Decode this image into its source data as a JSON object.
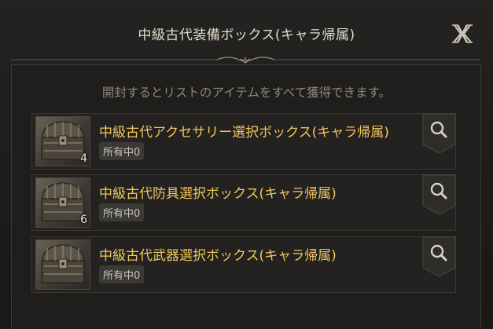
{
  "dialog": {
    "title": "中級古代装備ボックス(キャラ帰属)",
    "subtitle": "開封するとリストのアイテムをすべて獲得できます。"
  },
  "items": [
    {
      "name": "中級古代アクセサリー選択ボックス(キャラ帰属)",
      "count": "4",
      "badge": "所有中0"
    },
    {
      "name": "中級古代防具選択ボックス(キャラ帰属)",
      "count": "6",
      "badge": "所有中0"
    },
    {
      "name": "中級古代武器選択ボックス(キャラ帰属)",
      "count": "",
      "badge": "所有中0"
    }
  ],
  "colors": {
    "title_text": "#e2dccd",
    "item_name": "#f0c65e",
    "subtitle_text": "#8d877b",
    "background": "#1b1a18"
  },
  "icons": {
    "close": "close-icon",
    "search": "magnifier-icon",
    "item": "treasure-chest-icon"
  }
}
